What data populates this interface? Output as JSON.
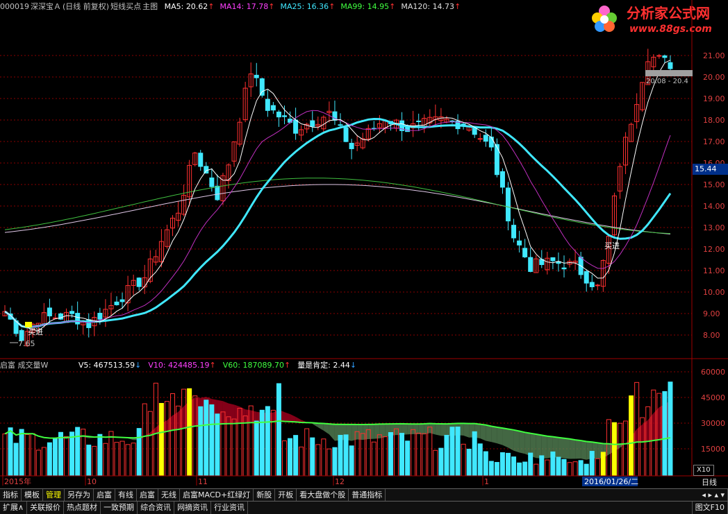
{
  "header": {
    "code": "000019",
    "name": "深深宝Ａ",
    "mode": "(日线 前复权)",
    "indicator": "短线买点",
    "panel": "主图",
    "ma": [
      {
        "label": "MA5:",
        "value": "20.62",
        "color": "#ffffff"
      },
      {
        "label": "MA14:",
        "value": "17.78",
        "color": "#ff40ff"
      },
      {
        "label": "MA25:",
        "value": "16.36",
        "color": "#40e8ff"
      },
      {
        "label": "MA99:",
        "value": "14.95",
        "color": "#40ff40"
      },
      {
        "label": "MA120:",
        "value": "14.73",
        "color": "#e0e0e0"
      }
    ],
    "arrow": "↑"
  },
  "logo": {
    "brand": "分析家公式网",
    "url": "www.88gs.com"
  },
  "price_axis": [
    "21.00",
    "20.00",
    "19.00",
    "18.00",
    "17.00",
    "16.00",
    "15.00",
    "14.00",
    "13.00",
    "12.00",
    "11.00",
    "10.00",
    "9.00",
    "8.00"
  ],
  "current_price": "15.44",
  "range_label": "20.08 - 20.4",
  "low_label": "7.65",
  "buy_labels": [
    "买进",
    "买进"
  ],
  "volume_header": {
    "title": "启富 成交量W",
    "items": [
      {
        "label": "V5:",
        "value": "467513.59",
        "arrow": "↓",
        "color": "#ffffff",
        "arrow_color": "#30a0ff"
      },
      {
        "label": "V10:",
        "value": "424485.19",
        "arrow": "↑",
        "color": "#ff40ff",
        "arrow_color": "#ff3030"
      },
      {
        "label": "V60:",
        "value": "187089.70",
        "arrow": "↑",
        "color": "#40ff40",
        "arrow_color": "#ff3030"
      },
      {
        "label": "量是肯定:",
        "value": "2.44",
        "arrow": "↓",
        "color": "#ffffff",
        "arrow_color": "#30a0ff"
      }
    ]
  },
  "volume_axis": [
    "60000",
    "45000",
    "30000",
    "15000"
  ],
  "volume_scale": "X10",
  "time_axis": {
    "labels": [
      "2015年",
      "10",
      "11",
      "12",
      "1"
    ],
    "highlight": "2016/01/26/二",
    "period": "日线"
  },
  "toolbar1": [
    "指标",
    "模板",
    "管理",
    "另存为",
    "启富",
    "有线",
    "启富",
    "无线",
    "启富MACD+红绿灯",
    "新股",
    "开板",
    "看大盘做个股",
    "普通指标"
  ],
  "toolbar1_active": 2,
  "toolbar2": [
    "扩展∧",
    "关联报价",
    "热点题材",
    "一致预期",
    "综合资讯",
    "网摘资讯",
    "行业资讯"
  ],
  "toolbar2_right": "图文F10",
  "colors": {
    "up": "#ff3030",
    "down": "#40e8ff",
    "grid": "#8b0000",
    "highlight_bar": "#ffff00"
  }
}
